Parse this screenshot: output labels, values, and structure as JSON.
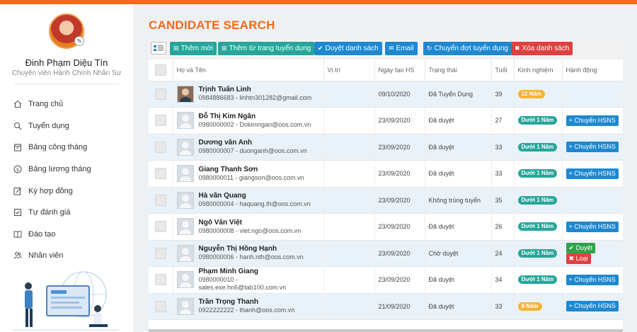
{
  "user": {
    "name": "Đinh Phạm Diệu Tín",
    "role": "Chuyên viên Hành Chính Nhân Sự"
  },
  "menu": [
    {
      "label": "Trang chủ",
      "icon": "home-icon"
    },
    {
      "label": "Tuyển dụng",
      "icon": "search-icon"
    },
    {
      "label": "Bảng công tháng",
      "icon": "calendar-icon"
    },
    {
      "label": "Bảng lương tháng",
      "icon": "dollar-icon"
    },
    {
      "label": "Ký hợp đồng",
      "icon": "edit-icon"
    },
    {
      "label": "Tự đánh giá",
      "icon": "assessment-icon"
    },
    {
      "label": "Đào tạo",
      "icon": "book-icon"
    },
    {
      "label": "Nhân viên",
      "icon": "people-icon"
    }
  ],
  "page_title": "CANDIDATE SEARCH",
  "toolbar": {
    "add": "Thêm mới",
    "add_from_page": "Thêm từ trang tuyển dụng",
    "approve_list": "Duyệt danh sách",
    "email": "Email",
    "move_round": "Chuyển đợt tuyển dụng",
    "delete_list": "Xóa danh sách"
  },
  "columns": [
    "Họ và Tên",
    "Vị trí",
    "Ngày tạo HS",
    "Trạng thái",
    "Tuổi",
    "Kinh nghiệm",
    "Hành động"
  ],
  "actions": {
    "transfer": "Chuyển HSNS",
    "approve": "Duyệt",
    "reject": "Loại"
  },
  "colors": {
    "accent": "#f26b1d",
    "teal": "#26a69a",
    "blue": "#1e88d0",
    "red": "#e04040",
    "yellow": "#f5b335"
  },
  "rows": [
    {
      "name": "Trịnh Tuấn Linh",
      "contact": [
        "0984886683 - linhtn301282@gmail.com"
      ],
      "date": "09/10/2020",
      "status": "Đã Tuyển Dụng",
      "age": "39",
      "exp": "12 Năm",
      "exp_color": "yellow",
      "actions": [],
      "photo": true
    },
    {
      "name": "Đỗ Thị Kim Ngân",
      "contact": [
        "0980000002 - Dokimngan@oos.com.vn"
      ],
      "date": "23/09/2020",
      "status": "Đã duyệt",
      "age": "27",
      "exp": "Dưới 1 Năm",
      "exp_color": "teal",
      "actions": [
        "transfer"
      ],
      "photo": false
    },
    {
      "name": "Dương vân Anh",
      "contact": [
        "0980000007 - duonganh@oos.com.vn"
      ],
      "date": "23/09/2020",
      "status": "Đã duyệt",
      "age": "33",
      "exp": "Dưới 1 Năm",
      "exp_color": "teal",
      "actions": [
        "transfer"
      ],
      "photo": false
    },
    {
      "name": "Giang Thanh Sơn",
      "contact": [
        "0980000011 - giangson@oos.com.vn"
      ],
      "date": "23/09/2020",
      "status": "Đã duyệt",
      "age": "33",
      "exp": "Dưới 1 Năm",
      "exp_color": "teal",
      "actions": [
        "transfer"
      ],
      "photo": false
    },
    {
      "name": "Hà văn Quang",
      "contact": [
        "0980000004 - haquang.th@oos.com.vn"
      ],
      "date": "23/09/2020",
      "status": "Không trúng tuyển",
      "age": "35",
      "exp": "Dưới 1 Năm",
      "exp_color": "teal",
      "actions": [],
      "photo": false
    },
    {
      "name": "Ngô Văn Việt",
      "contact": [
        "0980000008 - viet.ngo@oos.com.vn"
      ],
      "date": "23/09/2020",
      "status": "Đã duyệt",
      "age": "26",
      "exp": "Dưới 1 Năm",
      "exp_color": "teal",
      "actions": [
        "transfer"
      ],
      "photo": false
    },
    {
      "name": "Nguyễn Thị Hồng Hạnh",
      "contact": [
        "0980000006 - hanh.nth@oos.com.vn"
      ],
      "date": "23/09/2020",
      "status": "Chờ duyệt",
      "age": "24",
      "exp": "Dưới 1 Năm",
      "exp_color": "teal",
      "actions": [
        "approve",
        "reject"
      ],
      "photo": false
    },
    {
      "name": "Phạm Minh Giang",
      "contact": [
        "0980000010 -",
        "sales.exe.hn6@tab100.com.vn"
      ],
      "date": "23/09/2020",
      "status": "Đã duyệt",
      "age": "34",
      "exp": "Dưới 1 Năm",
      "exp_color": "teal",
      "actions": [
        "transfer"
      ],
      "photo": false
    },
    {
      "name": "Trần Trọng Thanh",
      "contact": [
        "0922222222 - thanh@oos.com.vn"
      ],
      "date": "21/09/2020",
      "status": "Đã duyệt",
      "age": "33",
      "exp": "8 Năm",
      "exp_color": "yellow",
      "actions": [
        "transfer"
      ],
      "photo": false
    }
  ]
}
